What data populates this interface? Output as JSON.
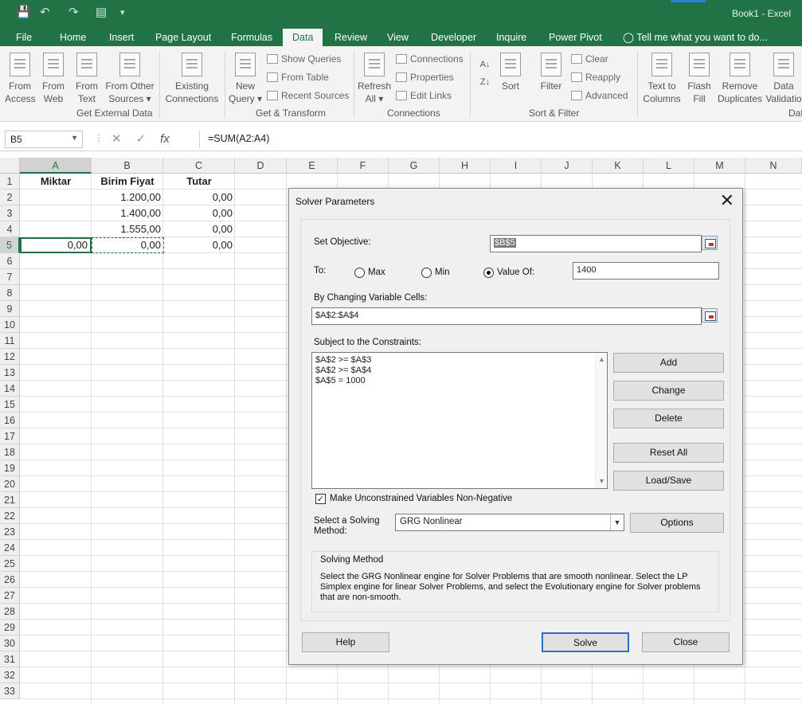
{
  "app": {
    "window_title": "Book1 - Excel"
  },
  "quick_access": {
    "save": "save-icon",
    "undo": "undo-icon",
    "redo": "redo-icon",
    "print_preview": "print-preview-icon",
    "customize": "customize-icon"
  },
  "tabs": [
    "File",
    "Home",
    "Insert",
    "Page Layout",
    "Formulas",
    "Data",
    "Review",
    "View",
    "Developer",
    "Inquire",
    "Power Pivot"
  ],
  "tell_me": "Tell me what you want to do...",
  "ribbon": {
    "groups": {
      "external": "Get External Data",
      "transform": "Get & Transform",
      "connections": "Connections",
      "sortfilter": "Sort & Filter",
      "datatools": "Dat"
    },
    "from_access": "From\nAccess",
    "from_web": "From\nWeb",
    "from_text": "From\nText",
    "from_other": "From Other\nSources ▾",
    "existing": "Existing\nConnections",
    "new_query": "New\nQuery ▾",
    "show_queries": "Show Queries",
    "from_table": "From Table",
    "recent_sources": "Recent Sources",
    "refresh_all": "Refresh\nAll ▾",
    "connections": "Connections",
    "properties": "Properties",
    "edit_links": "Edit Links",
    "sort": "Sort",
    "filter": "Filter",
    "clear": "Clear",
    "reapply": "Reapply",
    "advanced": "Advanced",
    "text_to_columns": "Text to\nColumns",
    "flash_fill": "Flash\nFill",
    "remove_duplicates": "Remove\nDuplicates",
    "data_validation": "Data\nValidatio"
  },
  "formula_bar": {
    "name_box": "B5",
    "formula": "=SUM(A2:A4)",
    "fx": "fx"
  },
  "grid": {
    "columns": [
      "A",
      "B",
      "C",
      "D",
      "E",
      "F",
      "G",
      "H",
      "I",
      "J",
      "K",
      "L",
      "M",
      "N"
    ],
    "rows": [
      "1",
      "2",
      "3",
      "4",
      "5",
      "6",
      "7",
      "8",
      "9",
      "10",
      "11",
      "12",
      "13",
      "14",
      "15",
      "16",
      "17",
      "18",
      "19",
      "20",
      "21",
      "22",
      "23",
      "24",
      "25",
      "26",
      "27",
      "28",
      "29",
      "30",
      "31",
      "32",
      "33"
    ],
    "headers": {
      "a1": "Miktar",
      "b1": "Birim Fiyat",
      "c1": "Tutar"
    },
    "b2": "1.200,00",
    "b3": "1.400,00",
    "b4": "1.555,00",
    "c2": "0,00",
    "c3": "0,00",
    "c4": "0,00",
    "c5": "0,00",
    "a5": "0,00",
    "b5": "0,00"
  },
  "dialog": {
    "title": "Solver Parameters",
    "set_objective_label": "Set Objective:",
    "set_objective_value": "$B$5",
    "to_label": "To:",
    "max_label": "Max",
    "min_label": "Min",
    "value_of_label": "Value Of:",
    "value_of_value": "1400",
    "changing_label": "By Changing Variable Cells:",
    "changing_value": "$A$2:$A$4",
    "constraints_label": "Subject to the Constraints:",
    "constraints": [
      "$A$2 >= $A$3",
      "$A$2 >= $A$4",
      "$A$5 = 1000"
    ],
    "add": "Add",
    "change": "Change",
    "delete": "Delete",
    "reset_all": "Reset All",
    "load_save": "Load/Save",
    "nonneg_label": "Make Unconstrained Variables Non-Negative",
    "select_method_label": "Select a Solving\nMethod:",
    "method_value": "GRG Nonlinear",
    "options": "Options",
    "method_box_title": "Solving Method",
    "method_box_text": "Select the GRG Nonlinear engine for Solver Problems that are smooth nonlinear. Select the LP Simplex engine for linear Solver Problems, and select the Evolutionary engine for Solver problems that are non-smooth.",
    "help": "Help",
    "solve": "Solve",
    "close": "Close"
  }
}
